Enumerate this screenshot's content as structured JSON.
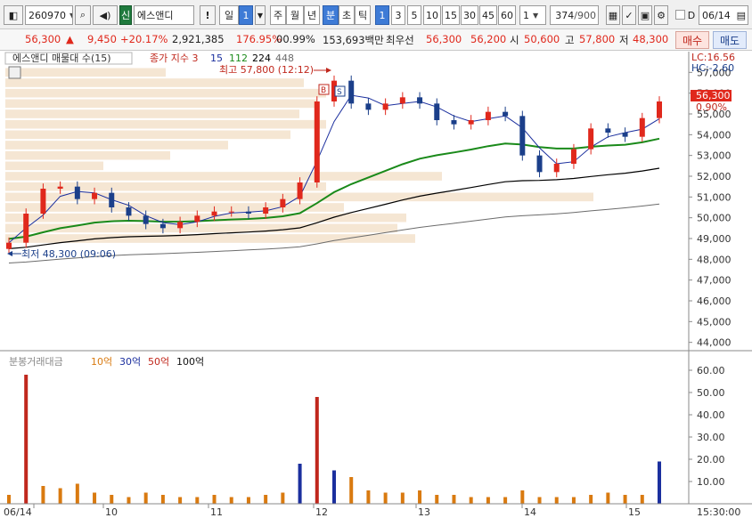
{
  "toolbar": {
    "code": "260970",
    "market_badge": "신",
    "name": "에스앤디",
    "alert": "!",
    "period_sel": "일",
    "period_num": "1",
    "periods": [
      "주",
      "월",
      "년"
    ],
    "minute": "분",
    "second": "초",
    "tick": "틱",
    "intervals": [
      "1",
      "3",
      "5",
      "10",
      "15",
      "30",
      "45",
      "60"
    ],
    "interval_input": "1",
    "count": "374",
    "count_total": "/900",
    "d_label": "D",
    "date": "06/14"
  },
  "quote": {
    "price": "56,300",
    "arrow": "▲",
    "change": "9,450",
    "change_pct": "+20.17%",
    "volume": "2,921,385",
    "vol_ratio": "176.95%",
    "turnover_pct": "00.99%",
    "amount": "153,693백만",
    "best_ask_label": "최우선",
    "best_ask": "56,300",
    "best_bid": "56,200",
    "open_label": "시",
    "open": "50,600",
    "high_label": "고",
    "high": "57,800",
    "low_label": "저",
    "low": "48,300",
    "buy_button": "매수",
    "sell_button": "매도"
  },
  "price_panel": {
    "overlay_label": "에스앤디 매물대 수(15)",
    "ma_label": "종가 지수 3",
    "ma_periods": [
      "15",
      "112",
      "224",
      "448"
    ],
    "ma_colors": [
      "#1b2f9e",
      "#1a8a1a",
      "#000000",
      "#6b6b6b"
    ],
    "high_annotation": "최고 57,800 (12:12)",
    "low_annotation": "최저 48,300 (09:06)",
    "lc_label": "LC:16.56",
    "hc_label": "HC:-2.60",
    "current_price_tag": "56,300",
    "current_pct_tag": "0.90%",
    "price_ticks": [
      "57,000",
      "56,000",
      "55,000",
      "54,000",
      "53,000",
      "52,000",
      "51,000",
      "50,000",
      "49,000",
      "48,000",
      "47,000",
      "46,000",
      "45,000",
      "44,000"
    ],
    "marker_b": "B",
    "marker_s": "S"
  },
  "volume_panel": {
    "title": "분봉거래대금",
    "legend": [
      {
        "label": "10억",
        "color": "#d97a10"
      },
      {
        "label": "30억",
        "color": "#1b2f9e"
      },
      {
        "label": "50억",
        "color": "#c0271c"
      },
      {
        "label": "100억",
        "color": "#111111"
      }
    ],
    "ticks": [
      "60.00",
      "50.00",
      "40.00",
      "30.00",
      "20.00",
      "10.00"
    ]
  },
  "x_axis": {
    "labels": [
      "06/14",
      "10",
      "11",
      "12",
      "13",
      "14",
      "15"
    ],
    "time_label": "15:30:00"
  },
  "colors": {
    "up": "#e0281c",
    "down": "#1b3f8a",
    "profile": "#f5e6d3",
    "accent": "#3e7bd6"
  },
  "chart_data": [
    {
      "type": "line",
      "title": "",
      "xlabel": "",
      "ylabel": "",
      "x": [
        "09:00",
        "09:10",
        "09:20",
        "09:30",
        "09:40",
        "09:50",
        "10:00",
        "10:10",
        "10:20",
        "10:30",
        "10:40",
        "10:50",
        "11:00",
        "11:10",
        "11:20",
        "11:30",
        "11:40",
        "11:50",
        "12:00",
        "12:10",
        "12:20",
        "12:30",
        "12:40",
        "12:50",
        "13:00",
        "13:10",
        "13:20",
        "13:30",
        "13:40",
        "13:50",
        "14:00",
        "14:10",
        "14:20",
        "14:30",
        "14:40",
        "14:50",
        "15:00",
        "15:10",
        "15:20"
      ],
      "series": [
        {
          "name": "",
          "values": [
            48800,
            50200,
            51400,
            51500,
            50900,
            51200,
            50500,
            50100,
            49700,
            49500,
            49800,
            50100,
            50300,
            50300,
            50200,
            50500,
            50900,
            51700,
            55600,
            56600,
            55500,
            55200,
            55500,
            55800,
            55500,
            54700,
            54500,
            54700,
            55100,
            54900,
            53000,
            52200,
            52600,
            53300,
            54300,
            54100,
            53900,
            54800,
            55600
          ]
        }
      ],
      "ylim": [
        43600,
        58000
      ]
    },
    {
      "type": "bar",
      "title": "",
      "xlabel": "",
      "ylabel": "",
      "x": [
        "09:00",
        "09:10",
        "09:20",
        "09:30",
        "09:40",
        "09:50",
        "10:00",
        "10:10",
        "10:20",
        "10:30",
        "10:40",
        "10:50",
        "11:00",
        "11:10",
        "11:20",
        "11:30",
        "11:40",
        "11:50",
        "12:00",
        "12:10",
        "12:20",
        "12:30",
        "12:40",
        "12:50",
        "13:00",
        "13:10",
        "13:20",
        "13:30",
        "13:40",
        "13:50",
        "14:00",
        "14:10",
        "14:20",
        "14:30",
        "14:40",
        "14:50",
        "15:00",
        "15:10",
        "15:20"
      ],
      "values": [
        4,
        58,
        8,
        7,
        9,
        5,
        4,
        3,
        5,
        4,
        3,
        3,
        4,
        3,
        3,
        4,
        5,
        18,
        48,
        15,
        12,
        6,
        5,
        5,
        6,
        4,
        4,
        3,
        3,
        3,
        6,
        3,
        3,
        3,
        4,
        5,
        4,
        4,
        19
      ],
      "ylim": [
        0,
        64
      ]
    }
  ]
}
